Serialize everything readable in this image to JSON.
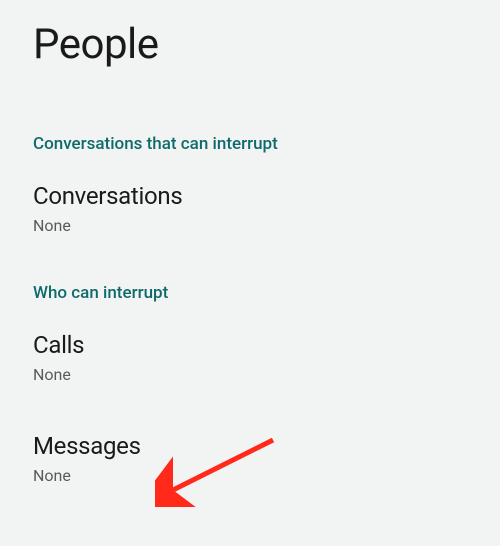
{
  "header": {
    "title": "People"
  },
  "sections": [
    {
      "header": "Conversations that can interrupt",
      "items": [
        {
          "title": "Conversations",
          "value": "None"
        }
      ]
    },
    {
      "header": "Who can interrupt",
      "items": [
        {
          "title": "Calls",
          "value": "None"
        },
        {
          "title": "Messages",
          "value": "None"
        }
      ]
    }
  ],
  "annotation": {
    "type": "arrow",
    "color": "#ff2a1a",
    "target": "messages-setting"
  }
}
